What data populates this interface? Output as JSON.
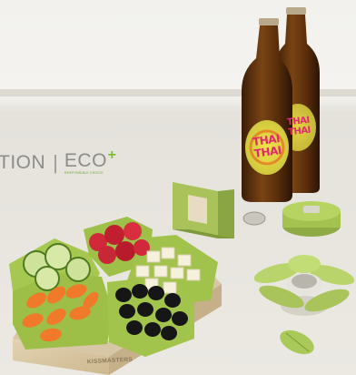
{
  "brand": {
    "partial_text": "TION",
    "separator": "|",
    "eco_word": "ECO",
    "eco_plus": "+",
    "eco_tagline": "RESPONSIBLE CHOICE"
  },
  "tray": {
    "logo_text": "KISSMASTERS"
  },
  "bottles": {
    "label_line1": "THAI",
    "label_line2": "THAI"
  },
  "colors": {
    "background": "#eeece6",
    "accent_green": "#8db83a",
    "beer_amber": "#6b3a10",
    "eco_plus": "#7cbf2e"
  }
}
